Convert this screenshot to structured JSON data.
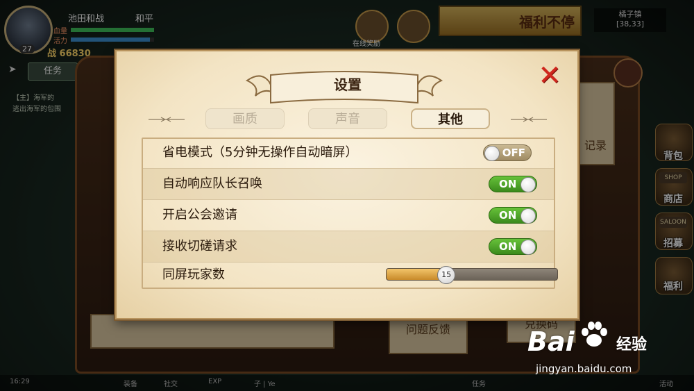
{
  "hud": {
    "player_name": "池田和战",
    "mode": "和平",
    "level": "27",
    "hp_label": "血量",
    "vigor_label": "活力",
    "power": "战 66830",
    "task_button": "任务",
    "chat_line_1": "【主】海军的",
    "chat_line_2": "逃出海军的包围"
  },
  "top": {
    "activity_label": "在线奖励",
    "banner_text": "福利不停",
    "town_name": "橘子镇",
    "town_coords": "[38,33]"
  },
  "side_menu": [
    {
      "label": "背包",
      "icon": "backpack-icon"
    },
    {
      "label": "商店",
      "icon": "shop-icon",
      "sign": "SHOP"
    },
    {
      "label": "招募",
      "icon": "recruit-icon",
      "sign": "SALOON"
    },
    {
      "label": "福利",
      "icon": "gift-icon"
    }
  ],
  "background": {
    "record_text": "记录",
    "feedback_text": "问题反馈",
    "redeem_text": "兑换码"
  },
  "bottom_bar": {
    "time": "16:29",
    "items": [
      "装备",
      "社交",
      "EXP",
      "子 | Ye",
      "任务",
      "活动"
    ]
  },
  "dialog": {
    "title": "设置",
    "tabs": [
      {
        "label": "画质",
        "active": false
      },
      {
        "label": "声音",
        "active": false
      },
      {
        "label": "其他",
        "active": true
      }
    ],
    "settings": [
      {
        "label": "省电模式（5分钟无操作自动暗屏）",
        "type": "toggle",
        "state": "OFF",
        "on": false
      },
      {
        "label": "自动响应队长召唤",
        "type": "toggle",
        "state": "ON",
        "on": true
      },
      {
        "label": "开启公会邀请",
        "type": "toggle",
        "state": "ON",
        "on": true
      },
      {
        "label": "接收切磋请求",
        "type": "toggle",
        "state": "ON",
        "on": true
      },
      {
        "label": "同屏玩家数",
        "type": "slider",
        "value": "15",
        "fill_fraction": 0.35
      }
    ]
  },
  "watermark": {
    "brand": "Bai",
    "brand_cn": "经验",
    "url": "jingyan.baidu.com"
  },
  "colors": {
    "toggle_on": "#4fa52a",
    "toggle_off": "#b09d74",
    "close_x": "#d0271d",
    "slider_fill": "#e0a848"
  }
}
